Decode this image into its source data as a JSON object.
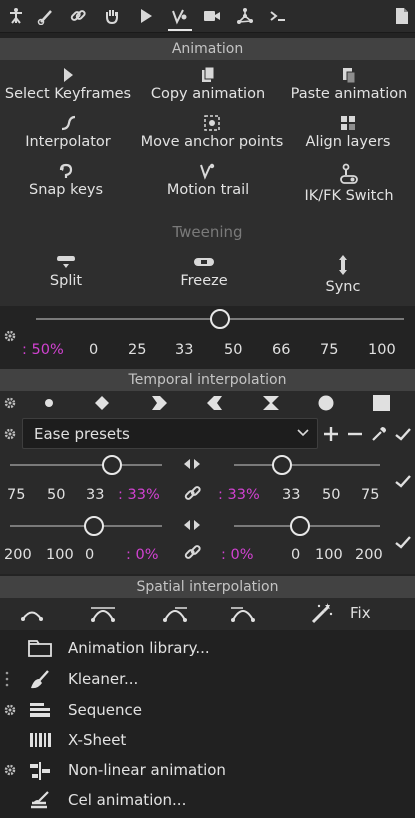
{
  "toolbar": {
    "icons": [
      "rig-icon",
      "bone-icon",
      "link-icon",
      "hand-icon",
      "play-icon",
      "animation-icon",
      "camera-icon",
      "nodes-icon",
      "terminal-icon",
      "document-icon"
    ],
    "active": "animation-icon"
  },
  "animation": {
    "title": "Animation",
    "tools": [
      {
        "label": "Select Keyframes",
        "icon": "select-keyframes-icon"
      },
      {
        "label": "Copy animation",
        "icon": "copy-animation-icon"
      },
      {
        "label": "Paste animation",
        "icon": "paste-animation-icon"
      },
      {
        "label": "Interpolator",
        "icon": "interpolator-icon"
      },
      {
        "label": "Move anchor points",
        "icon": "move-anchor-icon"
      },
      {
        "label": "Align layers",
        "icon": "align-layers-icon"
      },
      {
        "label": "Snap keys",
        "icon": "snap-keys-icon"
      },
      {
        "label": "Motion trail",
        "icon": "motion-trail-icon"
      },
      {
        "label": "IK/FK Switch",
        "icon": "ik-fk-icon"
      }
    ],
    "tweening_label": "Tweening",
    "tweening": [
      {
        "label": "Split",
        "icon": "split-icon"
      },
      {
        "label": "Freeze",
        "icon": "freeze-icon"
      },
      {
        "label": "Sync",
        "icon": "sync-icon"
      }
    ],
    "tween_slider": {
      "value_label": ": 50%",
      "value_fraction": 0.5,
      "ticks": [
        "0",
        "25",
        "33",
        "50",
        "66",
        "75",
        "100"
      ]
    }
  },
  "temporal": {
    "title": "Temporal interpolation",
    "key_types": [
      "circle-key-icon",
      "diamond-key-icon",
      "arrow-right-key-icon",
      "arrow-left-key-icon",
      "hourglass-key-icon",
      "round-key-icon",
      "square-key-icon"
    ],
    "preset": "Ease presets",
    "in_influence": {
      "value_label": ": 33%",
      "fraction": 0.67,
      "ticks": [
        "75",
        "50",
        "33"
      ]
    },
    "out_influence": {
      "value_label": ": 33%",
      "fraction": 0.33,
      "ticks": [
        "33",
        "50",
        "75"
      ]
    },
    "in_velocity": {
      "value_label": ": 0%",
      "fraction": 0.55,
      "ticks": [
        "200",
        "100",
        "0"
      ]
    },
    "out_velocity": {
      "value_label": ": 0%",
      "fraction": 0.45,
      "ticks": [
        "0",
        "100",
        "200"
      ]
    }
  },
  "spatial": {
    "title": "Spatial interpolation",
    "fix_label": "Fix"
  },
  "list": [
    {
      "label": "Animation library...",
      "icon": "folder-icon"
    },
    {
      "label": "Kleaner...",
      "icon": "broom-icon"
    },
    {
      "label": "Sequence",
      "icon": "sequence-icon"
    },
    {
      "label": "X-Sheet",
      "icon": "xsheet-icon"
    },
    {
      "label": "Non-linear animation",
      "icon": "nonlinear-icon"
    },
    {
      "label": "Cel animation...",
      "icon": "cel-animation-icon"
    }
  ],
  "colors": {
    "accent_pct": "#d042d0",
    "bg": "#232323",
    "panel": "#2e2e2e",
    "header": "#424242"
  }
}
